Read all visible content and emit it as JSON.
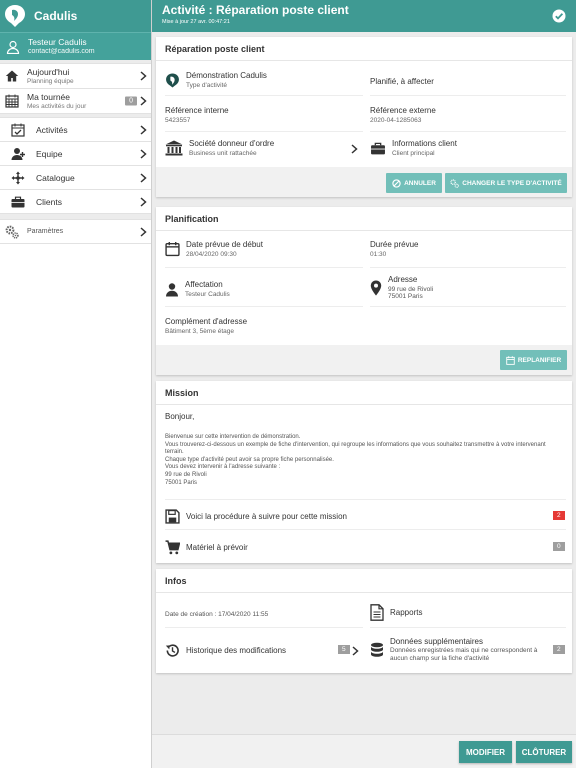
{
  "app": {
    "name": "Cadulis"
  },
  "user": {
    "name": "Testeur Cadulis",
    "email": "contact@cadulis.com"
  },
  "sidebar": {
    "today": {
      "label": "Aujourd'hui",
      "sub": "Planning équipe"
    },
    "tour": {
      "label": "Ma tournée",
      "sub": "Mes activités du jour",
      "badge": "0"
    },
    "items": [
      {
        "label": "Activités",
        "icon": "calendar-check-icon"
      },
      {
        "label": "Equipe",
        "icon": "user-add-icon"
      },
      {
        "label": "Catalogue",
        "icon": "move-arrows-icon"
      },
      {
        "label": "Clients",
        "icon": "briefcase-icon"
      }
    ],
    "settings": {
      "label": "Paramètres",
      "icon": "gears-icon"
    }
  },
  "header": {
    "title": "Activité : Réparation poste client",
    "updated": "Mise à jour 27 avr. 00:47:21"
  },
  "card_repair": {
    "title": "Réparation poste client",
    "type_name": "Démonstration Cadulis",
    "type_label": "Type d'activité",
    "status": "Planifié, à affecter",
    "ref_int_label": "Référence interne",
    "ref_int": "5423557",
    "ref_ext_label": "Référence externe",
    "ref_ext": "2020-04-1285063",
    "company_label": "Société donneur d'ordre",
    "company_sub": "Business unit rattachée",
    "client_label": "Informations client",
    "client_sub": "Client principal",
    "btn_cancel": "ANNULER",
    "btn_change": "CHANGER LE TYPE D'ACTIVITÉ"
  },
  "card_plan": {
    "title": "Planification",
    "start_label": "Date prévue de début",
    "start": "28/04/2020 09:30",
    "duration_label": "Durée prévue",
    "duration": "01:30",
    "assign_label": "Affectation",
    "assign": "Testeur Cadulis",
    "address_label": "Adresse",
    "address_l1": "99 rue de Rivoli",
    "address_l2": "75001 Paris",
    "complement_label": "Complément d'adresse",
    "complement": "Bâtiment 3, 5ème étage",
    "btn_replan": "REPLANIFIER"
  },
  "card_mission": {
    "title": "Mission",
    "hello": "Bonjour,",
    "lines": [
      "Bienvenue sur cette intervention de démonstration.",
      "Vous trouverez-ci-dessous un exemple de fiche d'intervention, qui regroupe les informations que vous souhaitez transmettre à votre intervenant terrain.",
      "Chaque type d'activité peut avoir sa propre fiche personnalisée.",
      "Vous devez intervenir à l'adresse suivante :",
      "99 rue de Rivoli",
      "75001 Paris"
    ],
    "procedure_label": "Voici la procédure à suivre pour cette mission",
    "procedure_badge": "2",
    "material_label": "Matériel à prévoir",
    "material_badge": "0"
  },
  "card_infos": {
    "title": "Infos",
    "created": "Date de création : 17/04/2020 11:55",
    "reports": "Rapports",
    "history": "Historique des modifications",
    "history_badge": "5",
    "extra_label": "Données supplémentaires",
    "extra_sub": "Données enregistrées mais qui ne correspondent à aucun champ sur la fiche d'activité",
    "extra_badge": "2"
  },
  "footer": {
    "modify": "MODIFIER",
    "close": "CLÔTURER"
  },
  "colors": {
    "primary": "#3f9a93",
    "button": "#72bfb9",
    "badge_red": "#e53935",
    "badge_gray": "#9e9e9e"
  }
}
